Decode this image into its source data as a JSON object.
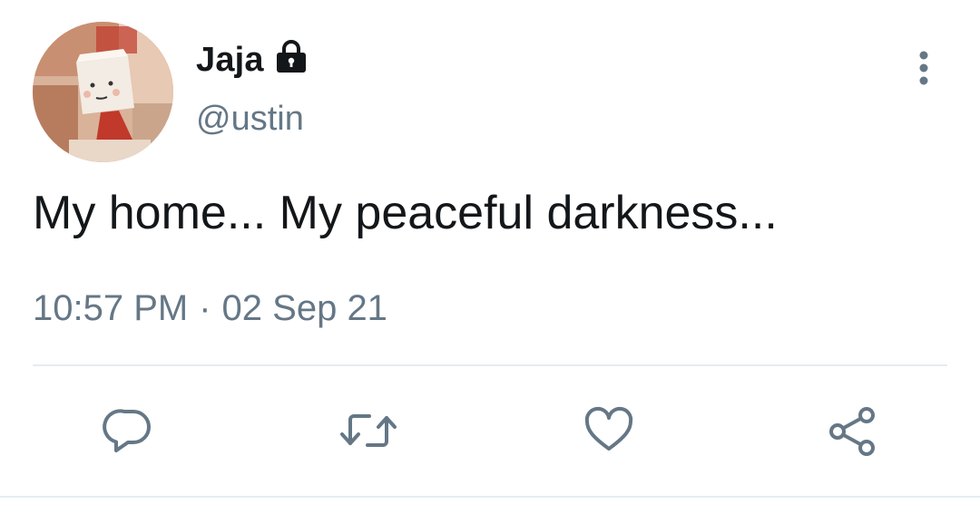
{
  "user": {
    "display_name": "Jaja",
    "handle": "@ustin",
    "protected": true,
    "protected_icon": "lock-icon",
    "avatar_icon": "avatar-image"
  },
  "tweet": {
    "text": "My home... My peaceful darkness...",
    "time": "10:57 PM",
    "separator": "·",
    "date": "02 Sep 21"
  },
  "actions": [
    {
      "name": "reply",
      "icon": "reply-icon"
    },
    {
      "name": "retweet",
      "icon": "retweet-icon"
    },
    {
      "name": "like",
      "icon": "heart-icon"
    },
    {
      "name": "share",
      "icon": "share-icon"
    }
  ],
  "menu": {
    "icon": "more-vertical-icon"
  },
  "colors": {
    "text_primary": "#14171a",
    "text_secondary": "#657786",
    "divider": "#e6ecf0"
  }
}
